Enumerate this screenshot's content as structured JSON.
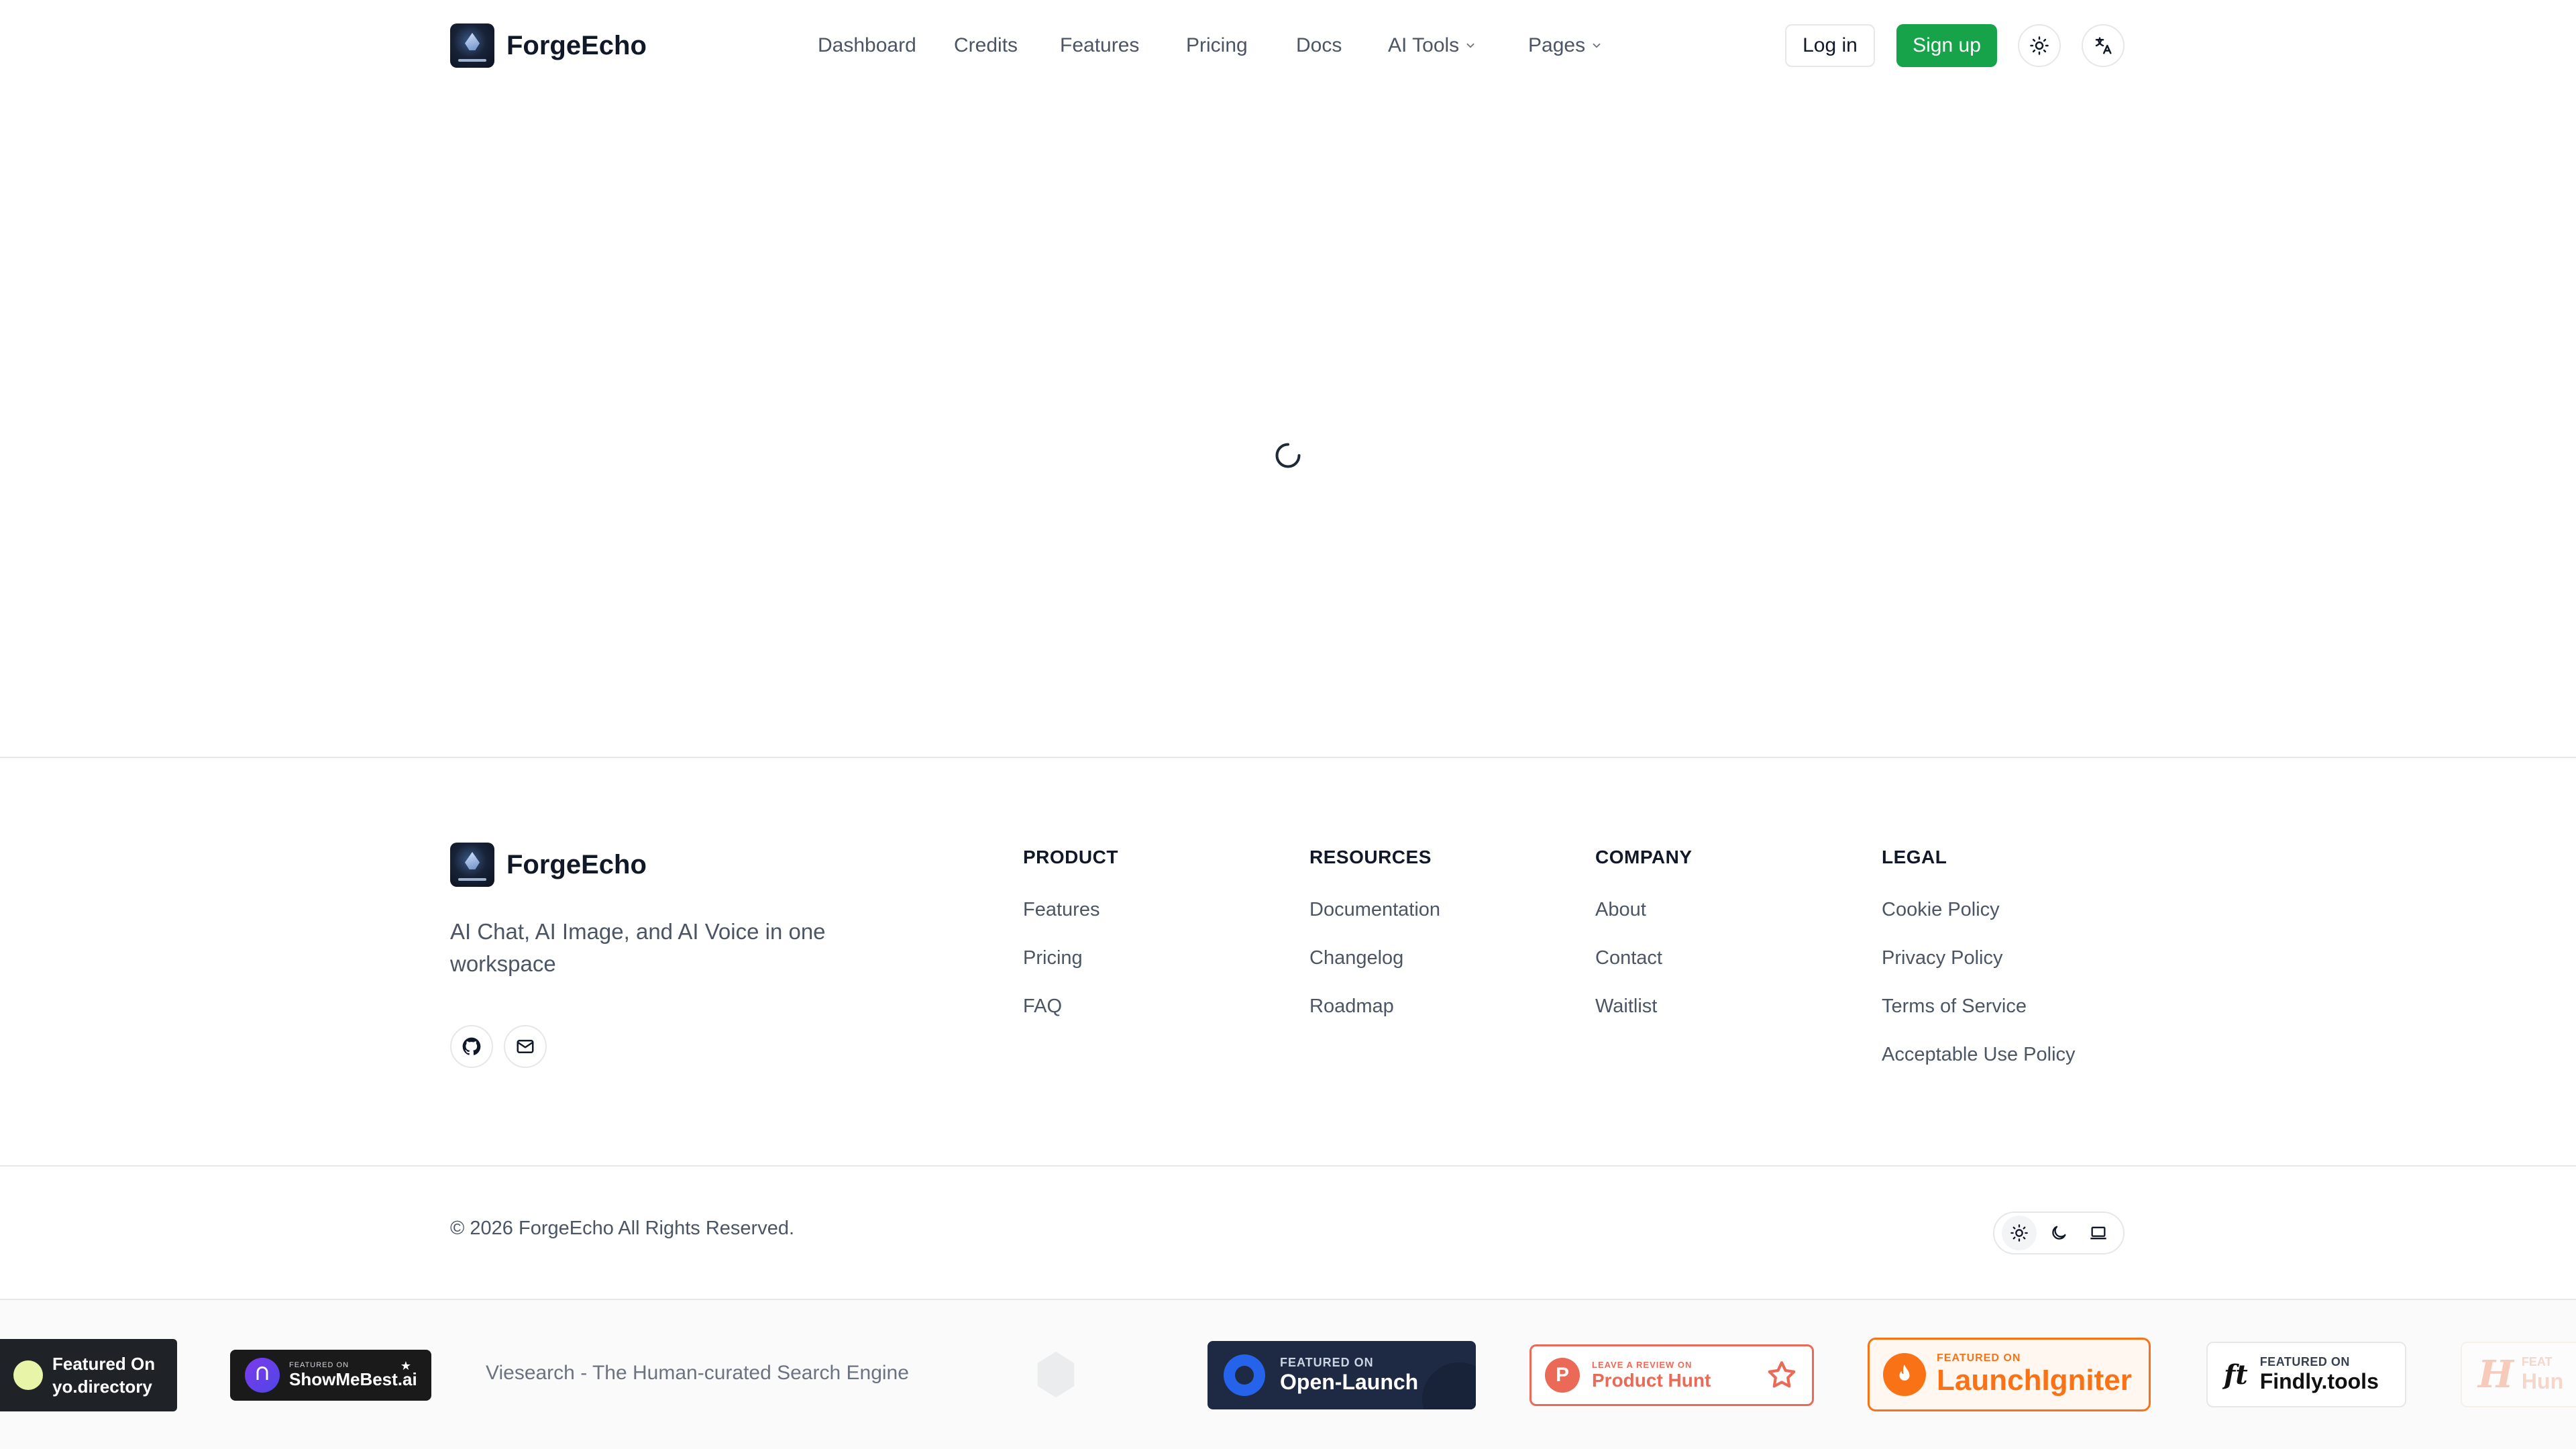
{
  "header": {
    "brand": "ForgeEcho",
    "nav": [
      {
        "label": "Dashboard"
      },
      {
        "label": "Credits"
      },
      {
        "label": "Features"
      },
      {
        "label": "Pricing"
      },
      {
        "label": "Docs"
      },
      {
        "label": "AI Tools",
        "has_dropdown": true
      },
      {
        "label": "Pages",
        "has_dropdown": true
      }
    ],
    "login_label": "Log in",
    "signup_label": "Sign up",
    "icons": [
      "sun-icon",
      "translate-icon"
    ]
  },
  "main": {
    "state": "loading",
    "icon": "spinner-icon"
  },
  "footer": {
    "brand": "ForgeEcho",
    "tagline": "AI Chat, AI Image, and AI Voice in one workspace",
    "social_icons": [
      "github-icon",
      "mail-icon"
    ],
    "columns": [
      {
        "title": "PRODUCT",
        "links": [
          "Features",
          "Pricing",
          "FAQ"
        ]
      },
      {
        "title": "RESOURCES",
        "links": [
          "Documentation",
          "Changelog",
          "Roadmap"
        ]
      },
      {
        "title": "COMPANY",
        "links": [
          "About",
          "Contact",
          "Waitlist"
        ]
      },
      {
        "title": "LEGAL",
        "links": [
          "Cookie Policy",
          "Privacy Policy",
          "Terms of Service",
          "Acceptable Use Policy"
        ]
      }
    ],
    "copyright": "© 2026 ForgeEcho All Rights Reserved.",
    "theme_options": [
      "sun-icon",
      "moon-icon",
      "laptop-icon"
    ]
  },
  "badges": {
    "yo": {
      "line1": "Featured On",
      "line2": "yo.directory"
    },
    "showmebest": {
      "small": "FEATURED ON",
      "big": "ShowMeBest.ai"
    },
    "viesearch": "Viesearch - The Human-curated Search Engine",
    "open_launch": {
      "small": "FEATURED ON",
      "big": "Open-Launch"
    },
    "product_hunt": {
      "small": "LEAVE A REVIEW ON",
      "big": "Product Hunt"
    },
    "launchigniter": {
      "small": "FEATURED ON",
      "big": "LaunchIgniter"
    },
    "findly": {
      "small": "FEATURED ON",
      "big": "Findly.tools"
    },
    "partial": {
      "small": "FEAT",
      "big": "Hun"
    }
  },
  "colors": {
    "accent_green": "#16a34a",
    "product_hunt": "#ea6a57",
    "launchigniter": "#f97316",
    "open_launch_bg": "#1e2a44"
  }
}
